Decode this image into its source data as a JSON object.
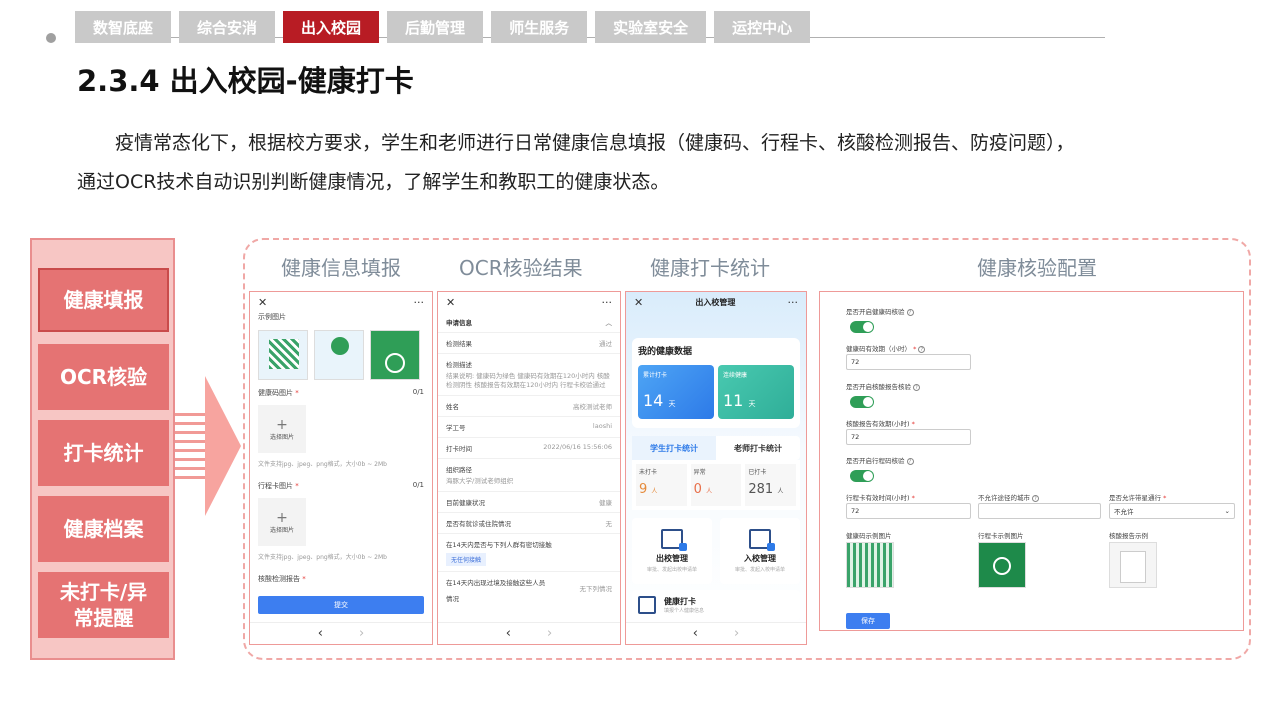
{
  "nav": {
    "tabs": [
      "数智底座",
      "综合安消",
      "出入校园",
      "后勤管理",
      "师生服务",
      "实验室安全",
      "运控中心"
    ],
    "active_index": 2
  },
  "title": "2.3.4 出入校园-健康打卡",
  "description": {
    "line1": "疫情常态化下，根据校方要求，学生和老师进行日常健康信息填报（健康码、行程卡、核酸检测报告、防疫问题），",
    "line2": "通过OCR技术自动识别判断健康情况，了解学生和教职工的健康状态。"
  },
  "left_menu": [
    "健康填报",
    "OCR核验",
    "打卡统计",
    "健康档案",
    "未打卡/异常提醒"
  ],
  "sections": {
    "s1": "健康信息填报",
    "s2": "OCR核验结果",
    "s3": "健康打卡统计",
    "s4": "健康核验配置"
  },
  "phone1": {
    "close": "✕",
    "more": "···",
    "example_label": "示例图片",
    "health_code_label": "健康码图片",
    "health_code_count": "0/1",
    "upload_label": "选择图片",
    "hint": "文件支持jpg、jpeg、png格式，大小0b ~ 2Mb",
    "trip_label": "行程卡图片",
    "trip_count": "0/1",
    "nucleic_label": "核酸检测报告",
    "submit": "提交",
    "back": "‹",
    "forward": "›"
  },
  "phone2": {
    "close": "✕",
    "more": "···",
    "header": "申请信息",
    "rows": [
      {
        "label": "检测结果",
        "value": "通过"
      }
    ],
    "desc_label": "检测描述",
    "desc_text": "结果说明: 健康码为绿色 健康码有效期在120小时内 核酸检测阴性 核酸报告有效期在120小时内 行程卡校验通过",
    "rows2": [
      {
        "label": "姓名",
        "value": "高校测试老师"
      },
      {
        "label": "学工号",
        "value": "laoshi"
      },
      {
        "label": "打卡时间",
        "value": "2022/06/16 15:56:06"
      }
    ],
    "route_label": "组织路径",
    "route_value": "海豚大学/测试老师组织",
    "rows3": [
      {
        "label": "目前健康状况",
        "value": "健康"
      },
      {
        "label": "是否有就诊或住院情况",
        "value": "无"
      }
    ],
    "q1": "在14天内是否与下列人群有密切接触",
    "q1_tag": "无任何接触",
    "q2": "在14天内出现过境及接触这些人员",
    "q2_value": "无下列情况",
    "q2_sub": "情况",
    "back": "‹",
    "forward": "›"
  },
  "phone3": {
    "close": "✕",
    "title": "出入校管理",
    "more": "···",
    "card_title": "我的健康数据",
    "stat1_label": "累计打卡",
    "stat1_value": "14",
    "stat1_unit": "天",
    "stat2_label": "连续健康",
    "stat2_value": "11",
    "stat2_unit": "天",
    "tab_student": "学生打卡统计",
    "tab_teacher": "老师打卡统计",
    "ms1_label": "未打卡",
    "ms1_value": "9",
    "ms2_label": "异常",
    "ms2_value": "0",
    "ms3_label": "已打卡",
    "ms3_value": "281",
    "unit_person": "人",
    "tile1": "出校管理",
    "tile1_sub": "审批、发起出校申请单",
    "tile2": "入校管理",
    "tile2_sub": "审批、发起入校申请单",
    "wide": "健康打卡",
    "wide_sub": "填报个人健康信息",
    "back": "‹",
    "forward": "›"
  },
  "config": {
    "q1": "是否开启健康码核验",
    "hc_valid_label": "健康码有效期（小时）",
    "hc_valid_value": "72",
    "q2": "是否开启核酸报告核验",
    "nat_valid_label": "核酸报告有效期(小时)",
    "nat_valid_value": "72",
    "q3": "是否开启行程码核验",
    "trip_valid_label": "行程卡有效时间(小时)",
    "trip_valid_value": "72",
    "city_label": "不允许途径的城市",
    "city_value": "",
    "allow_label": "是否允许带星通行",
    "allow_value": "不允许",
    "sample1": "健康码示例图片",
    "sample2": "行程卡示例图片",
    "sample3": "核酸报告示例",
    "save": "保存"
  }
}
